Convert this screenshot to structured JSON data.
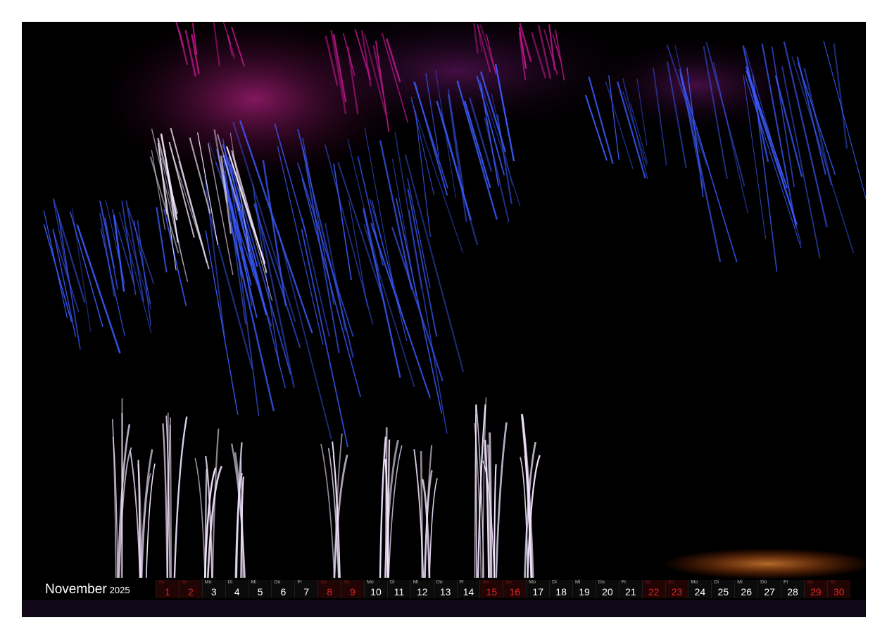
{
  "calendar": {
    "month": "November",
    "year": "2025",
    "days": [
      {
        "wd": "Sa",
        "d": "1",
        "we": true
      },
      {
        "wd": "So",
        "d": "2",
        "we": true
      },
      {
        "wd": "Mo",
        "d": "3"
      },
      {
        "wd": "Di",
        "d": "4"
      },
      {
        "wd": "Mi",
        "d": "5"
      },
      {
        "wd": "Do",
        "d": "6"
      },
      {
        "wd": "Fr",
        "d": "7"
      },
      {
        "wd": "Sa",
        "d": "8",
        "we": true
      },
      {
        "wd": "So",
        "d": "9",
        "we": true
      },
      {
        "wd": "Mo",
        "d": "10"
      },
      {
        "wd": "Di",
        "d": "11"
      },
      {
        "wd": "Mi",
        "d": "12"
      },
      {
        "wd": "Do",
        "d": "13"
      },
      {
        "wd": "Fr",
        "d": "14"
      },
      {
        "wd": "Sa",
        "d": "15",
        "we": true
      },
      {
        "wd": "So",
        "d": "16",
        "we": true
      },
      {
        "wd": "Mo",
        "d": "17"
      },
      {
        "wd": "Di",
        "d": "18"
      },
      {
        "wd": "Mi",
        "d": "19"
      },
      {
        "wd": "Do",
        "d": "20"
      },
      {
        "wd": "Fr",
        "d": "21"
      },
      {
        "wd": "Sa",
        "d": "22",
        "we": true
      },
      {
        "wd": "So",
        "d": "23",
        "we": true
      },
      {
        "wd": "Mo",
        "d": "24"
      },
      {
        "wd": "Di",
        "d": "25"
      },
      {
        "wd": "Mi",
        "d": "26"
      },
      {
        "wd": "Do",
        "d": "27"
      },
      {
        "wd": "Fr",
        "d": "28"
      },
      {
        "wd": "Sa",
        "d": "29",
        "we": true
      },
      {
        "wd": "So",
        "d": "30",
        "we": true
      }
    ]
  },
  "colors": {
    "weekend": "#e02424",
    "firework_blue": "#3b5bff",
    "firework_magenta": "#c2188f",
    "firework_white": "#f4e6ff"
  }
}
